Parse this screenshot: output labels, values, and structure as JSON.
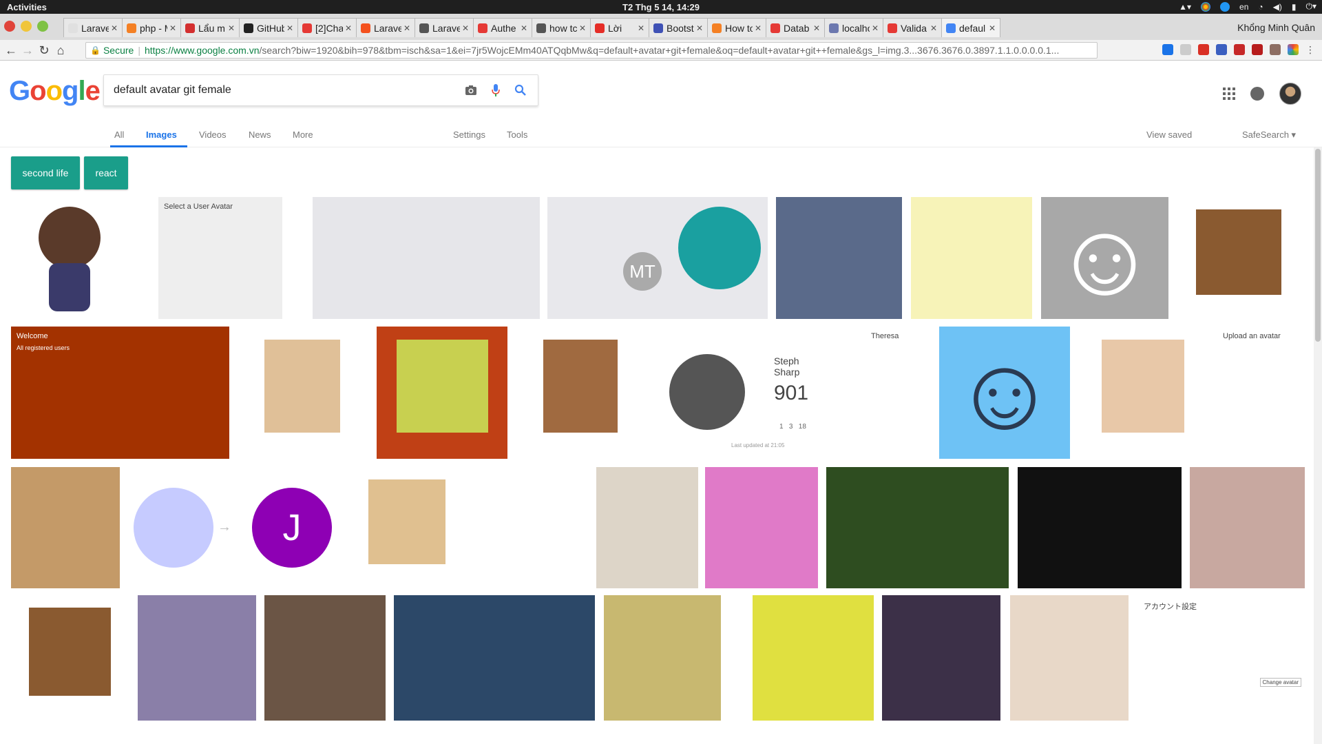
{
  "system_bar": {
    "activities": "Activities",
    "clock": "T2 Thg 5 14, 14:29",
    "lang": "en"
  },
  "browser": {
    "tabs": [
      {
        "label": "Larave",
        "favicon_color": "#e0e0e0"
      },
      {
        "label": "php - M",
        "favicon_color": "#f48024"
      },
      {
        "label": "Lẩu m",
        "favicon_color": "#d32f2f"
      },
      {
        "label": "GitHub",
        "favicon_color": "#222222"
      },
      {
        "label": "[2]Cha",
        "favicon_color": "#e53935"
      },
      {
        "label": "Larave",
        "favicon_color": "#f4511e"
      },
      {
        "label": "Larave",
        "favicon_color": "#555555"
      },
      {
        "label": "Authe",
        "favicon_color": "#e53935"
      },
      {
        "label": "how tc",
        "favicon_color": "#555555"
      },
      {
        "label": "Lời",
        "favicon_color": "#e52d27"
      },
      {
        "label": "Bootst",
        "favicon_color": "#3f51b5"
      },
      {
        "label": "How to",
        "favicon_color": "#f48024"
      },
      {
        "label": "Datab",
        "favicon_color": "#e53935"
      },
      {
        "label": "localho",
        "favicon_color": "#6c78af"
      },
      {
        "label": "Valida",
        "favicon_color": "#e53935"
      },
      {
        "label": "defaul",
        "favicon_color": "#4285f4",
        "active": true
      }
    ],
    "profile_name": "Khổng Minh Quân",
    "secure_label": "Secure",
    "url_host": "https://www.google.com.vn",
    "url_rest": "/search?biw=1920&bih=978&tbm=isch&sa=1&ei=7jr5WojcEMm40ATQqbMw&q=default+avatar+git+female&oq=default+avatar+git++female&gs_l=img.3...3676.3676.0.3897.1.1.0.0.0.0.1..."
  },
  "google": {
    "logo": [
      "G",
      "o",
      "o",
      "g",
      "l",
      "e"
    ],
    "logo_colors": [
      "#4285f4",
      "#ea4335",
      "#fbbc05",
      "#4285f4",
      "#34a853",
      "#ea4335"
    ],
    "query": "default avatar git female",
    "nav": {
      "all": "All",
      "images": "Images",
      "videos": "Videos",
      "news": "News",
      "more": "More",
      "settings": "Settings",
      "tools": "Tools",
      "view_saved": "View saved",
      "safesearch": "SafeSearch"
    },
    "chips": [
      "second life",
      "react"
    ]
  },
  "image_results": {
    "row1": [
      {
        "name": "octocat-female",
        "color": "#ffffff"
      },
      {
        "name": "select-user-avatar",
        "color": "#eeeeee",
        "caption": "Select a User Avatar"
      },
      {
        "name": "avatar-collage-1",
        "color": "#e6e6ea"
      },
      {
        "name": "avatar-collage-mt",
        "color": "#e8e8ec",
        "initials": "MT"
      },
      {
        "name": "purple-hair-woman",
        "color": "#5a6a8a"
      },
      {
        "name": "flash-mask",
        "color": "#f7f3b8"
      },
      {
        "name": "gray-smiley",
        "color": "#a8a8a8"
      },
      {
        "name": "pixel-woman-brown",
        "color": "#ffffff"
      }
    ],
    "row2": [
      {
        "name": "welcome-registered-users",
        "color": "#a33200",
        "caption": "Welcome",
        "subcaption": "All registered users"
      },
      {
        "name": "pixel-blonde",
        "color": "#ffffff"
      },
      {
        "name": "pixel-purple-hat",
        "color": "#c04015"
      },
      {
        "name": "pixel-heart-glasses",
        "color": "#ffffff"
      },
      {
        "name": "steph-sharp",
        "color": "#ffffff",
        "caption": "Steph Sharp",
        "score": "901",
        "badges": "1   3   18",
        "footer": "Last updated at 21:05"
      },
      {
        "name": "phone-profile",
        "color": "#ffffff",
        "caption": "Theresa"
      },
      {
        "name": "blue-smiley",
        "color": "#6ec2f5"
      },
      {
        "name": "pixel-woman-yellow",
        "color": "#ffffff"
      },
      {
        "name": "upload-avatar",
        "color": "#ffffff",
        "caption": "Upload an avatar"
      }
    ],
    "row3": [
      {
        "name": "smiling-woman-scarf",
        "color": "#c49a68"
      },
      {
        "name": "default-person-to-j",
        "color": "#ffffff",
        "initial": "J"
      },
      {
        "name": "pixel-bald-beard",
        "color": "#ffffff"
      },
      {
        "name": "bw-portrait-popart",
        "color": "#ffffff"
      },
      {
        "name": "woman-seated",
        "color": "#ddd5c8"
      },
      {
        "name": "pink-avatar-3d",
        "color": "#e07ac8"
      },
      {
        "name": "red-hair-woman",
        "color": "#2e4d20"
      },
      {
        "name": "dark-hair-profile",
        "color": "#111111"
      },
      {
        "name": "woman-bangs",
        "color": "#c8a8a0"
      }
    ],
    "row4": [
      {
        "name": "pixel-dark-man",
        "color": "#ffffff"
      },
      {
        "name": "blonde-woman-photo",
        "color": "#8a7fa8"
      },
      {
        "name": "woman-glasses",
        "color": "#6b5545"
      },
      {
        "name": "wonder-woman-art",
        "color": "#2c4868"
      },
      {
        "name": "anime-blonde",
        "color": "#c8b870"
      },
      {
        "name": "woman-selfie",
        "color": "#e0e040"
      },
      {
        "name": "dark-fantasy-woman",
        "color": "#3c3048"
      },
      {
        "name": "kendall-red-dress",
        "color": "#e8d8c8"
      },
      {
        "name": "account-settings-jp",
        "color": "#ffffff",
        "caption": "アカウント設定",
        "button": "Change avatar"
      }
    ]
  }
}
